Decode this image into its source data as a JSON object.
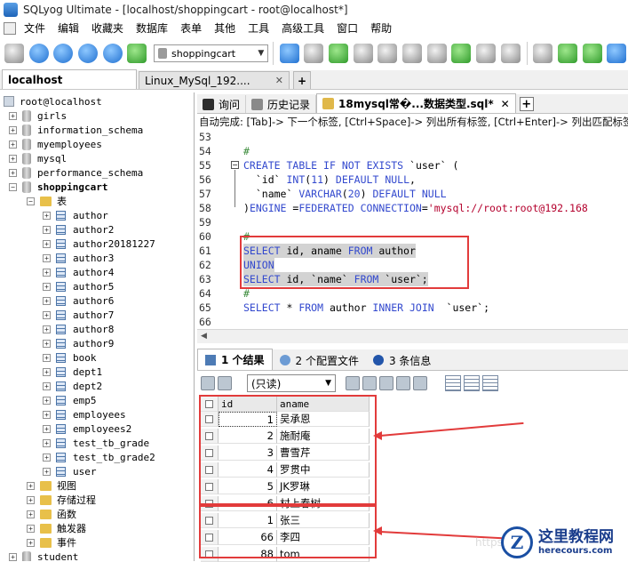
{
  "window": {
    "title": "SQLyog Ultimate - [localhost/shoppingcart - root@localhost*]"
  },
  "menu": [
    "文件",
    "编辑",
    "收藏夹",
    "数据库",
    "表单",
    "其他",
    "工具",
    "高级工具",
    "窗口",
    "帮助"
  ],
  "toolbar": {
    "db_select": "shoppingcart"
  },
  "connection_tabs": [
    {
      "label": "localhost",
      "active": true
    },
    {
      "label": "Linux_MySql_192....",
      "active": false
    }
  ],
  "tree": {
    "root": "root@localhost",
    "databases": [
      "girls",
      "information_schema",
      "myemployees",
      "mysql",
      "performance_schema",
      "shoppingcart"
    ],
    "tables_folder": "表",
    "tables": [
      "author",
      "author2",
      "author20181227",
      "author3",
      "author4",
      "author5",
      "author6",
      "author7",
      "author8",
      "author9",
      "book",
      "dept1",
      "dept2",
      "emp5",
      "employees",
      "employees2",
      "test_tb_grade",
      "test_tb_grade2",
      "user"
    ],
    "other_folders": [
      "视图",
      "存储过程",
      "函数",
      "触发器",
      "事件"
    ],
    "next_database": "student"
  },
  "editor_tabs": [
    {
      "label": "询问",
      "active": false
    },
    {
      "label": "历史记录",
      "active": false
    },
    {
      "label": "18mysql常�...数据类型.sql*",
      "active": true
    }
  ],
  "autocomplete_hint": "自动完成: [Tab]-> 下一个标签, [Ctrl+Space]-> 列出所有标签, [Ctrl+Enter]-> 列出匹配标签",
  "code_lines": [
    {
      "n": "53",
      "text": ""
    },
    {
      "n": "54",
      "text": "#"
    },
    {
      "n": "55",
      "text": "CREATE TABLE IF NOT EXISTS `user` ("
    },
    {
      "n": "56",
      "text": "  `id` INT(11) DEFAULT NULL,"
    },
    {
      "n": "57",
      "text": "  `name` VARCHAR(20) DEFAULT NULL"
    },
    {
      "n": "58",
      "text": ")ENGINE =FEDERATED CONNECTION='mysql://root:root@192.168"
    },
    {
      "n": "59",
      "text": ""
    },
    {
      "n": "60",
      "text": "#"
    },
    {
      "n": "61",
      "text": "SELECT id, aname FROM author"
    },
    {
      "n": "62",
      "text": "UNION"
    },
    {
      "n": "63",
      "text": "SELECT id, `name` FROM `user`;"
    },
    {
      "n": "64",
      "text": "#"
    },
    {
      "n": "65",
      "text": "SELECT * FROM author INNER JOIN  `user`;"
    },
    {
      "n": "66",
      "text": ""
    }
  ],
  "result_tabs": [
    {
      "label": "1 个结果",
      "active": true
    },
    {
      "label": "2 个配置文件",
      "active": false
    },
    {
      "label": "3 条信息",
      "active": false
    }
  ],
  "result_toolbar": {
    "mode": "(只读)"
  },
  "grid": {
    "columns": [
      "id",
      "aname"
    ],
    "rows": [
      [
        "1",
        "吴承恩"
      ],
      [
        "2",
        "施耐庵"
      ],
      [
        "3",
        "曹雪芹"
      ],
      [
        "4",
        "罗贯中"
      ],
      [
        "5",
        "JK罗琳"
      ],
      [
        "6",
        "村上春树"
      ],
      [
        "1",
        "张三"
      ],
      [
        "66",
        "李四"
      ],
      [
        "88",
        "tom"
      ]
    ]
  },
  "watermark": {
    "brand": "这里教程网",
    "url": "herecours.com",
    "logo_letter": "Z",
    "faint": "https://bl"
  },
  "colors": {
    "highlight_box": "#e23b3b",
    "keyword": "#3349ce",
    "string": "#b4002d",
    "comment": "#3c8c3c"
  }
}
